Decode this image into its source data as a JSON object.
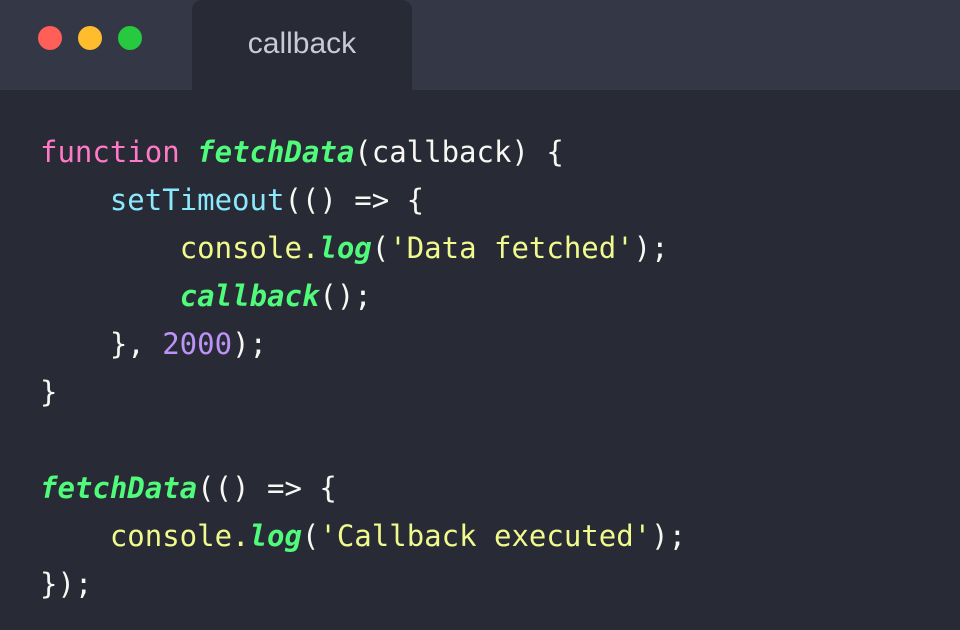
{
  "window": {
    "tab_title": "callback"
  },
  "code": {
    "lines": [
      [
        {
          "t": "function",
          "c": "kw"
        },
        {
          "t": " ",
          "c": "plain"
        },
        {
          "t": "fetchData",
          "c": "fn"
        },
        {
          "t": "(callback) {",
          "c": "plain"
        }
      ],
      [
        {
          "t": "    ",
          "c": "plain"
        },
        {
          "t": "setTimeout",
          "c": "builtin"
        },
        {
          "t": "(() => {",
          "c": "plain"
        }
      ],
      [
        {
          "t": "        ",
          "c": "plain"
        },
        {
          "t": "console.",
          "c": "ident"
        },
        {
          "t": "log",
          "c": "fn"
        },
        {
          "t": "(",
          "c": "plain"
        },
        {
          "t": "'Data fetched'",
          "c": "str"
        },
        {
          "t": ");",
          "c": "plain"
        }
      ],
      [
        {
          "t": "        ",
          "c": "plain"
        },
        {
          "t": "callback",
          "c": "fn"
        },
        {
          "t": "();",
          "c": "plain"
        }
      ],
      [
        {
          "t": "    }, ",
          "c": "plain"
        },
        {
          "t": "2000",
          "c": "num"
        },
        {
          "t": ");",
          "c": "plain"
        }
      ],
      [
        {
          "t": "}",
          "c": "plain"
        }
      ],
      [],
      [
        {
          "t": "fetchData",
          "c": "fn"
        },
        {
          "t": "(() => {",
          "c": "plain"
        }
      ],
      [
        {
          "t": "    ",
          "c": "plain"
        },
        {
          "t": "console.",
          "c": "ident"
        },
        {
          "t": "log",
          "c": "fn"
        },
        {
          "t": "(",
          "c": "plain"
        },
        {
          "t": "'Callback executed'",
          "c": "str"
        },
        {
          "t": ");",
          "c": "plain"
        }
      ],
      [
        {
          "t": "});",
          "c": "plain"
        }
      ]
    ]
  }
}
